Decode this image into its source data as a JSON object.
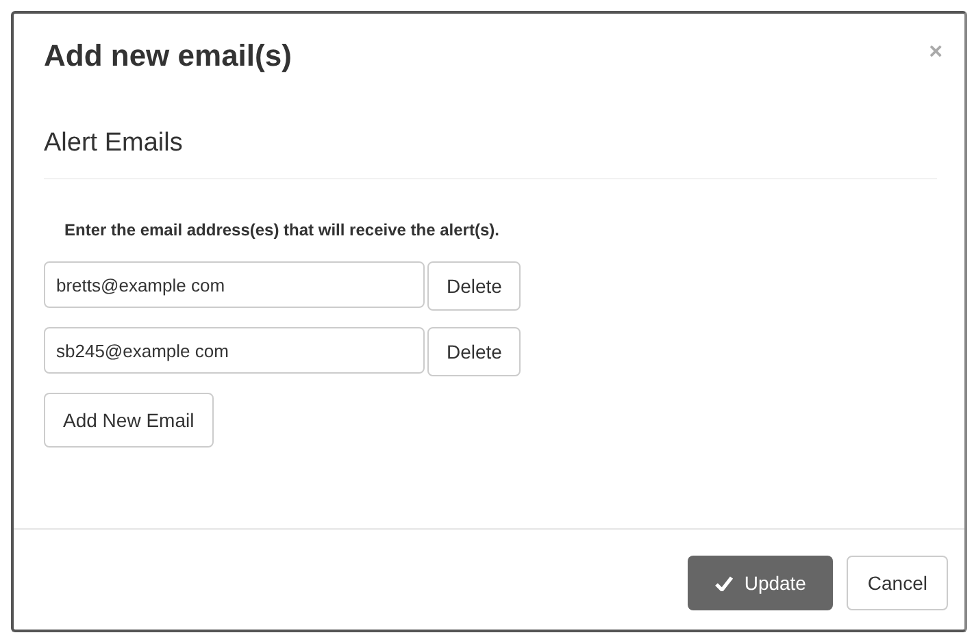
{
  "dialog": {
    "title": "Add new email(s)",
    "close": "×"
  },
  "section": {
    "heading": "Alert Emails",
    "instruction": "Enter the email address(es) that will receive the alert(s)."
  },
  "emails": [
    {
      "value": "bretts@example com",
      "delete": "Delete"
    },
    {
      "value": "sb245@example com",
      "delete": "Delete"
    }
  ],
  "add_button": "Add New Email",
  "footer": {
    "update": "Update",
    "cancel": "Cancel"
  }
}
